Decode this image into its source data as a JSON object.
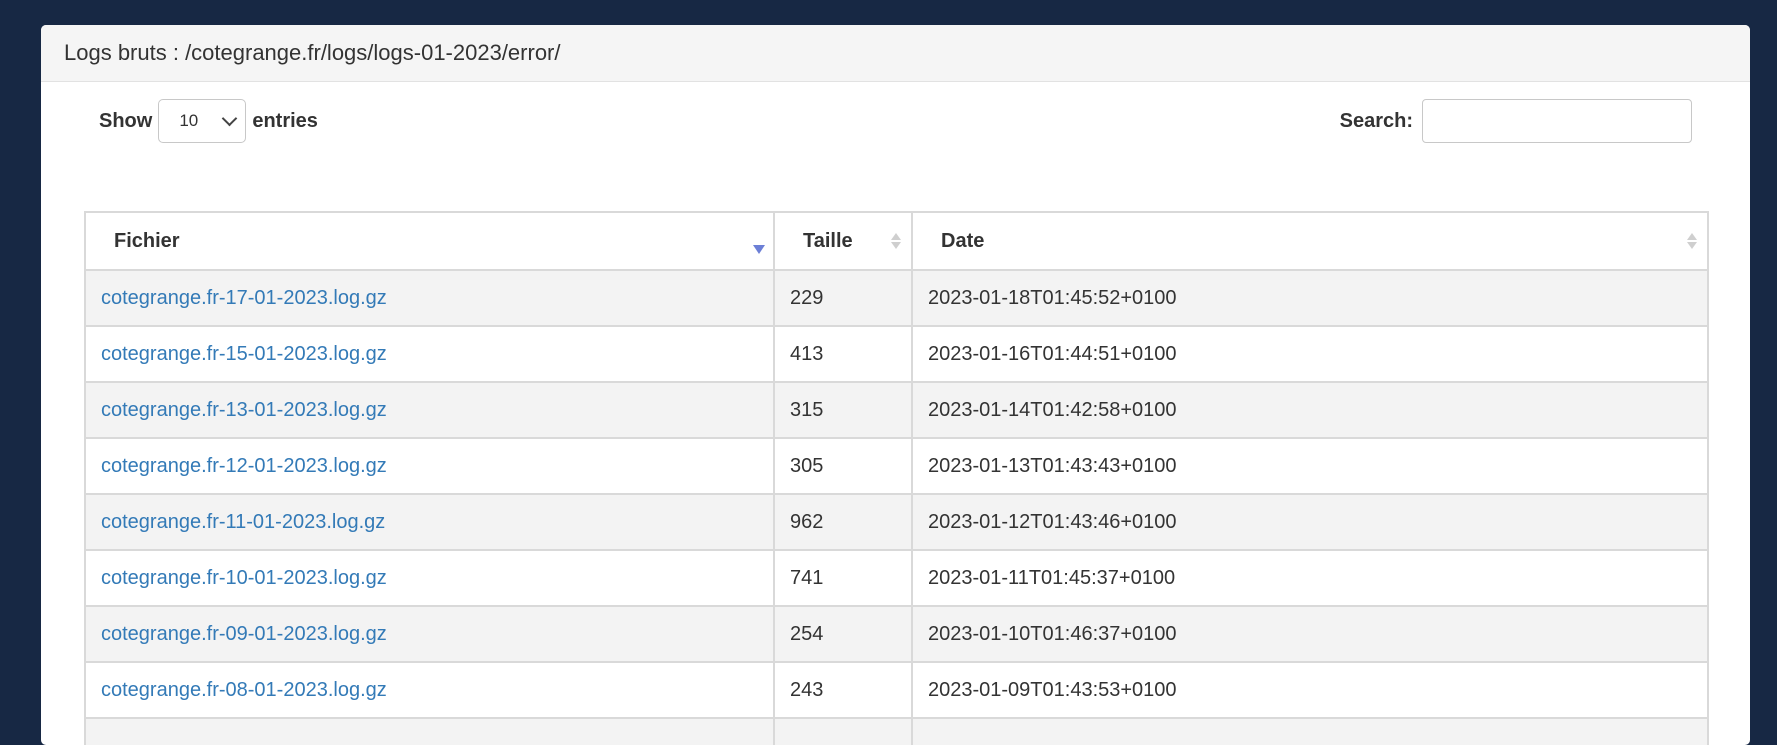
{
  "panel": {
    "title": "Logs bruts : /cotegrange.fr/logs/logs-01-2023/error/"
  },
  "length_control": {
    "show_label": "Show",
    "selected": "10",
    "entries_label": "entries"
  },
  "search": {
    "label": "Search:",
    "value": ""
  },
  "table": {
    "columns": [
      "Fichier",
      "Taille",
      "Date"
    ],
    "rows": [
      {
        "file": "cotegrange.fr-17-01-2023.log.gz",
        "size": "229",
        "date": "2023-01-18T01:45:52+0100"
      },
      {
        "file": "cotegrange.fr-15-01-2023.log.gz",
        "size": "413",
        "date": "2023-01-16T01:44:51+0100"
      },
      {
        "file": "cotegrange.fr-13-01-2023.log.gz",
        "size": "315",
        "date": "2023-01-14T01:42:58+0100"
      },
      {
        "file": "cotegrange.fr-12-01-2023.log.gz",
        "size": "305",
        "date": "2023-01-13T01:43:43+0100"
      },
      {
        "file": "cotegrange.fr-11-01-2023.log.gz",
        "size": "962",
        "date": "2023-01-12T01:43:46+0100"
      },
      {
        "file": "cotegrange.fr-10-01-2023.log.gz",
        "size": "741",
        "date": "2023-01-11T01:45:37+0100"
      },
      {
        "file": "cotegrange.fr-09-01-2023.log.gz",
        "size": "254",
        "date": "2023-01-10T01:46:37+0100"
      },
      {
        "file": "cotegrange.fr-08-01-2023.log.gz",
        "size": "243",
        "date": "2023-01-09T01:43:53+0100"
      },
      {
        "file": "",
        "size": "",
        "date": ""
      }
    ]
  },
  "colors": {
    "page_background": "#172844",
    "link": "#337ab7",
    "sort_active": "#6c7fd6"
  },
  "icons": {
    "sort_active": "sort-desc-icon",
    "sort_inactive": "sort-both-icon",
    "select_chevron": "chevron-down-icon"
  }
}
